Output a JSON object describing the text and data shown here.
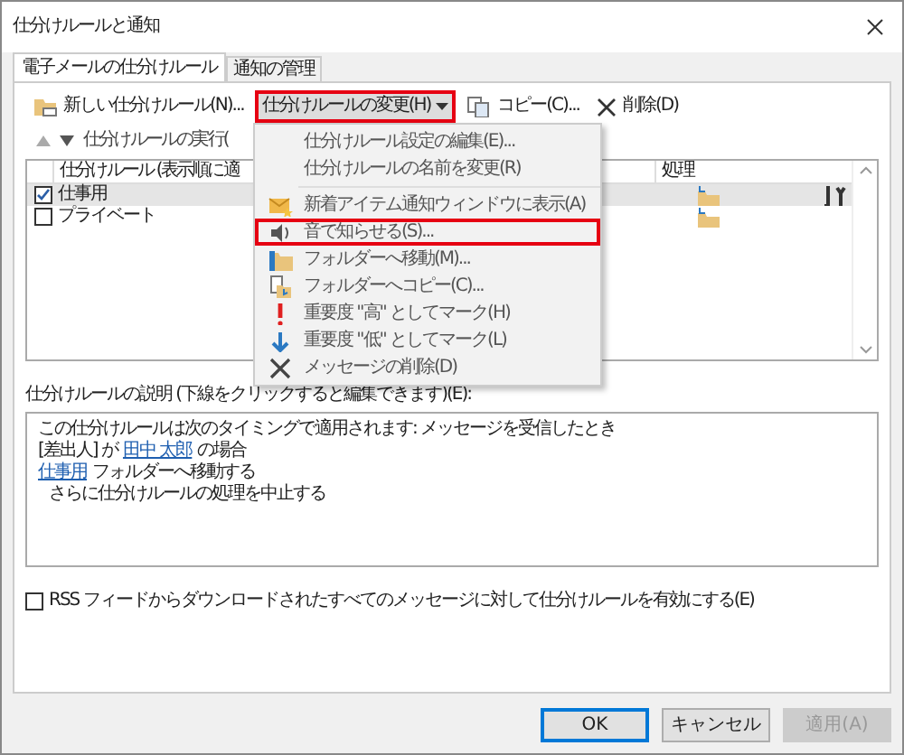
{
  "window": {
    "title": "仕分けルールと通知"
  },
  "tabs": [
    {
      "label": "電子メールの仕分けルール",
      "selected": true
    },
    {
      "label": "通知の管理",
      "selected": false
    }
  ],
  "toolbar": [
    {
      "kind": "new",
      "label": "新しい仕分けルール(N)...",
      "highlighted": false
    },
    {
      "kind": "dropdown",
      "label": "仕分けルールの変更(H)",
      "highlighted": true
    },
    {
      "kind": "copy",
      "label": "コピー(C)...",
      "highlighted": false
    },
    {
      "kind": "delete",
      "label": "削除(D)",
      "highlighted": false
    }
  ],
  "run_label": "仕分けルールの実行(",
  "table": {
    "columns": [
      "仕分けルール (表示順に適",
      "処理"
    ],
    "rows": [
      {
        "kind": "with-tools",
        "name": "仕事用",
        "checked": true,
        "selected": true
      },
      {
        "kind": "plain",
        "name": "プライベート",
        "checked": false,
        "selected": false
      }
    ]
  },
  "menu": [
    {
      "kind": "item",
      "label": "仕分けルール設定の編集(E)...",
      "highlighted": false
    },
    {
      "kind": "item",
      "label": "仕分けルールの名前を変更(R)",
      "highlighted": false
    },
    {
      "kind": "separator"
    },
    {
      "kind": "item",
      "label": "新着アイテム通知ウィンドウに表示(A)",
      "highlighted": false
    },
    {
      "kind": "item",
      "label": "音で知らせる(S)...",
      "highlighted": true
    },
    {
      "kind": "item",
      "label": "フォルダーへ移動(M)...",
      "highlighted": false
    },
    {
      "kind": "item",
      "label": "フォルダーへコピー(C)...",
      "highlighted": false
    },
    {
      "kind": "item",
      "label": "重要度 \"高\" としてマーク(H)",
      "highlighted": false
    },
    {
      "kind": "item",
      "label": "重要度 \"低\" としてマーク(L)",
      "highlighted": false
    },
    {
      "kind": "item",
      "label": "メッセージの削除(D)",
      "highlighted": false
    }
  ],
  "description": {
    "label": "仕分けルールの説明 (下線をクリックすると編集できます)(E):",
    "lines": [
      {
        "kind": "plain",
        "parts": [
          {
            "text": "この仕分けルールは次のタイミングで適用されます: メッセージを受信したとき",
            "link": false
          }
        ]
      },
      {
        "kind": "plain",
        "parts": [
          {
            "text": "[差出人] が",
            "link": false
          },
          {
            "text": "田中 太郎",
            "link": true
          },
          {
            "text": "の場合",
            "link": false
          }
        ]
      },
      {
        "kind": "plain",
        "parts": [
          {
            "text": "仕事用",
            "link": true
          },
          {
            "text": "フォルダーへ移動する",
            "link": false
          }
        ]
      },
      {
        "kind": "indented",
        "parts": [
          {
            "text": "さらに仕分けルールの処理を中止する",
            "link": false
          }
        ]
      }
    ]
  },
  "rss": {
    "label": "RSS フィードからダウンロードされたすべてのメッセージに対して仕分けルールを有効にする(E)",
    "checked": false
  },
  "buttons": [
    {
      "label": "OK",
      "default": true,
      "disabled": false
    },
    {
      "label": "キャンセル",
      "default": false,
      "disabled": false
    },
    {
      "label": "適用(A)",
      "default": false,
      "disabled": true
    }
  ]
}
